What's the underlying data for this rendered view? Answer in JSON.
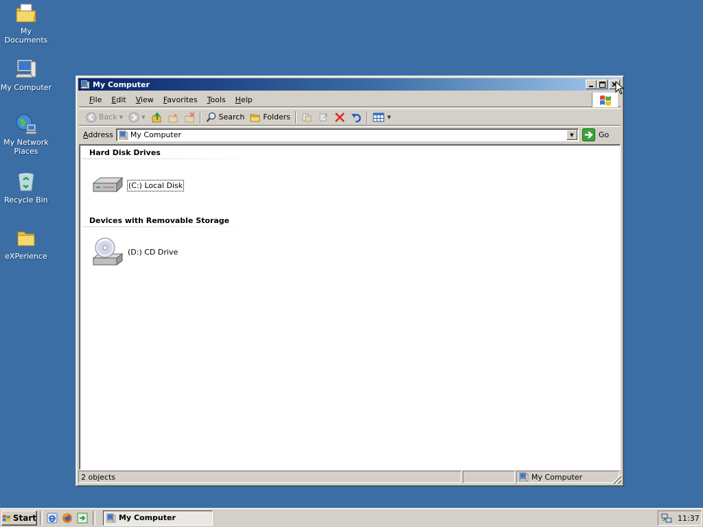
{
  "desktop": {
    "background": "#3a6ea5",
    "icons": [
      {
        "label": "My Documents",
        "icon": "my-documents-icon"
      },
      {
        "label": "My Computer",
        "icon": "my-computer-icon"
      },
      {
        "label": "My Network Places",
        "icon": "network-places-icon"
      },
      {
        "label": "Recycle Bin",
        "icon": "recycle-bin-icon"
      },
      {
        "label": "eXPerience",
        "icon": "folder-icon"
      }
    ]
  },
  "window": {
    "title": "My Computer",
    "menu": [
      "File",
      "Edit",
      "View",
      "Favorites",
      "Tools",
      "Help"
    ],
    "toolbar": {
      "back": "Back",
      "search": "Search",
      "folders": "Folders"
    },
    "address": {
      "label": "Address",
      "value": "My Computer",
      "go": "Go"
    },
    "groups": [
      {
        "title": "Hard Disk Drives",
        "items": [
          {
            "label": "(C:) Local Disk",
            "icon": "hard-disk-icon"
          }
        ]
      },
      {
        "title": "Devices with Removable Storage",
        "items": [
          {
            "label": "(D:) CD Drive",
            "icon": "cd-drive-icon"
          }
        ]
      }
    ],
    "status": {
      "count": "2 objects",
      "zone": "My Computer"
    }
  },
  "taskbar": {
    "start": "Start",
    "task": "My Computer",
    "clock": "11:37"
  }
}
